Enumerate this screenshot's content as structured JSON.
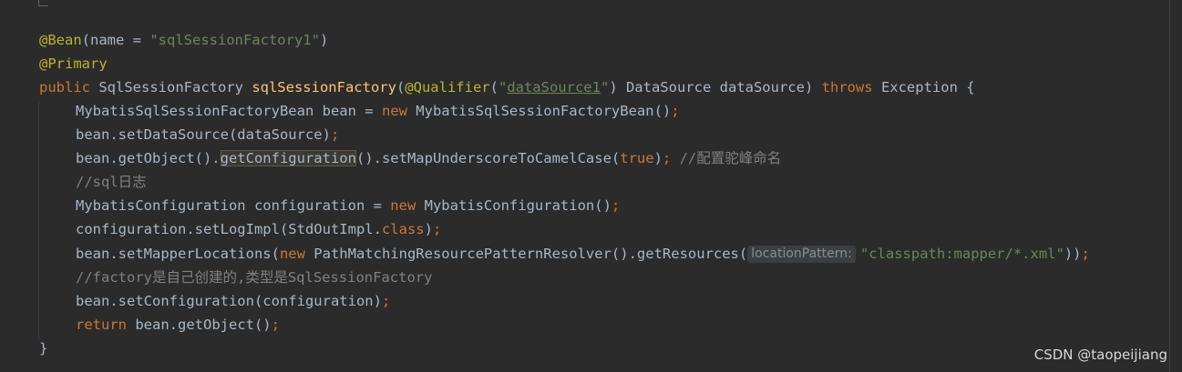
{
  "code": {
    "line1": {
      "annotation": "@Bean",
      "open": "(name = ",
      "name_value": "\"sqlSessionFactory1\"",
      "close": ")"
    },
    "line2": {
      "annotation": "@Primary"
    },
    "line3": {
      "public": "public",
      "return_type": " SqlSessionFactory ",
      "method": "sqlSessionFactory",
      "paren_open": "(",
      "qualifier": "@Qualifier",
      "q_open": "(",
      "quote_open": "\"",
      "qualifier_value": "dataSource1",
      "quote_close": "\"",
      "param": ") DataSource dataSource) ",
      "throws": "throws",
      "exception": " Exception {"
    },
    "line4": {
      "decl": "MybatisSqlSessionFactoryBean bean = ",
      "new_kw": "new",
      "ctor": " MybatisSqlSessionFactoryBean()",
      "semi": ";"
    },
    "line5": {
      "call": "bean.setDataSource(dataSource)",
      "semi": ";"
    },
    "line6": {
      "pre": "bean.getObject().",
      "highlighted": "getConfiguration",
      "post": "().setMapUnderscoreToCamelCase(",
      "true_kw": "true",
      "close": ")",
      "semi": ";",
      "comment": " //配置驼峰命名"
    },
    "line7": {
      "comment": "//sql日志"
    },
    "line8": {
      "decl": "MybatisConfiguration configuration = ",
      "new_kw": "new",
      "ctor": " MybatisConfiguration()",
      "semi": ";"
    },
    "line9": {
      "pre": "configuration.setLogImpl(StdOutImpl.",
      "class_kw": "class",
      "close": ")",
      "semi": ";"
    },
    "line10": {
      "pre": "bean.setMapperLocations(",
      "new_kw": "new",
      "mid": " PathMatchingResourcePatternResolver().getResources(",
      "hint": "locationPattern:",
      "value": "\"classpath:mapper/*.xml\"",
      "close": "))",
      "semi": ";"
    },
    "line11": {
      "comment": "//factory是自己创建的,类型是SqlSessionFactory"
    },
    "line12": {
      "call": "bean.setConfiguration(configuration)",
      "semi": ";"
    },
    "line13": {
      "return_kw": "return",
      "call": " bean.getObject()",
      "semi": ";"
    },
    "line14": {
      "brace": "}"
    }
  },
  "watermark": "CSDN @taopeijiang",
  "colors": {
    "background": "#2b2b2b",
    "default_text": "#a9b7c6",
    "annotation": "#bbb529",
    "keyword": "#cc7832",
    "string": "#6a8759",
    "method_decl": "#ffc66d",
    "comment": "#808080"
  }
}
